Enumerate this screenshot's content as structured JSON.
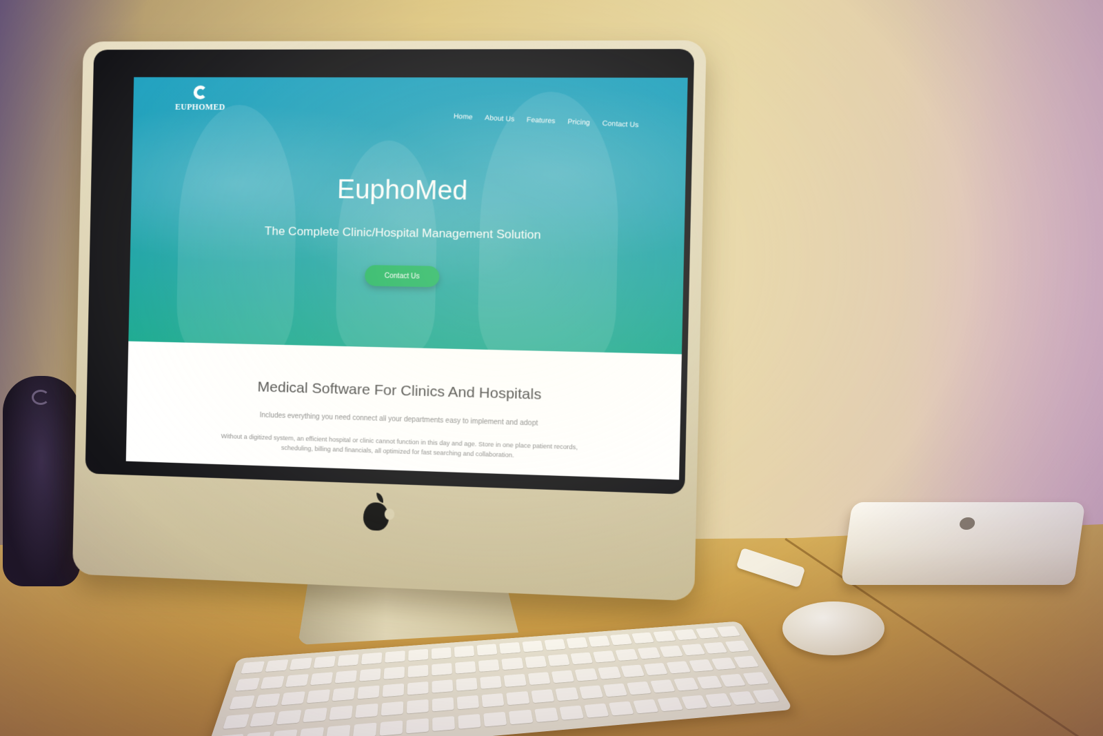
{
  "site": {
    "logo_text": "EUPHOMED",
    "nav": [
      {
        "label": "Home"
      },
      {
        "label": "About Us"
      },
      {
        "label": "Features"
      },
      {
        "label": "Pricing"
      },
      {
        "label": "Contact Us"
      }
    ],
    "hero": {
      "title": "EuphoMed",
      "subtitle": "The Complete Clinic/Hospital Management Solution",
      "cta_label": "Contact Us"
    },
    "section": {
      "title": "Medical Software For Clinics And Hospitals",
      "lead": "Includes everything you need connect all your departments easy to implement and adopt",
      "body": "Without a digitized system, an efficient hospital or clinic cannot function in this day and age. Store in one place patient records, scheduling, billing and financials, all optimized for fast searching and collaboration."
    }
  },
  "colors": {
    "hero_top": "#1da0c0",
    "hero_bottom": "#16a88f",
    "cta": "#19b45f",
    "section_title": "#4a4a4a",
    "section_text": "#8a8a8a"
  },
  "icons": {
    "logo": "euphomed-logo-icon",
    "device_brand": "apple-icon"
  }
}
